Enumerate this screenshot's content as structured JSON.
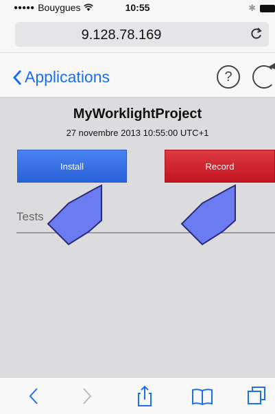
{
  "status_bar": {
    "carrier": "Bouygues",
    "signal_dots": "●●●●●",
    "time": "10:55"
  },
  "address_bar": {
    "url": "9.128.78.169"
  },
  "nav_bar": {
    "back_label": "Applications",
    "help_symbol": "?"
  },
  "project": {
    "title": "MyWorklightProject",
    "date": "27 novembre 2013 10:55:00 UTC+1"
  },
  "buttons": {
    "install_label": "Install",
    "record_label": "Record"
  },
  "tests": {
    "label": "Tests"
  },
  "colors": {
    "ios_blue": "#1a6ff0",
    "install_blue": "#2862d8",
    "record_red": "#c0141f",
    "annotation_arrow": "#6b7cf0"
  },
  "toolbar_icons": [
    "back-icon",
    "forward-icon",
    "share-icon",
    "bookmarks-icon",
    "tabs-icon"
  ]
}
